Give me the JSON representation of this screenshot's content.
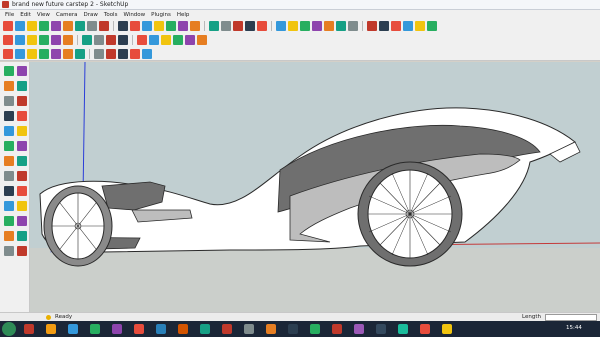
{
  "window": {
    "title": "brand new future carstep 2 - SketchUp"
  },
  "menu": [
    "File",
    "Edit",
    "View",
    "Camera",
    "Draw",
    "Tools",
    "Window",
    "Plugins",
    "Help"
  ],
  "status": {
    "message": "Ready",
    "length_label": "Length",
    "length_value": ""
  },
  "taskbar": {
    "time": "15:44"
  },
  "colors": {
    "sky": "#c1cfd1",
    "ground": "#cbcfcb",
    "axis_blue": "#2b3ed8",
    "axis_red": "#c43a3a",
    "car_body": "#ffffff",
    "car_panel": "#bdbdbd",
    "car_dark": "#6f6f6f",
    "taskbar": "#1b2637"
  },
  "icons": {
    "toolbar_row1": [
      "select-icon",
      "eraser-icon",
      "pencil-icon",
      "line-icon",
      "rectangle-icon",
      "circle-icon",
      "arc-icon",
      "polygon-icon",
      "freehand-icon",
      "push-pull-icon",
      "follow-me-icon",
      "offset-icon",
      "move-icon",
      "rotate-icon",
      "scale-icon",
      "tape-measure-icon",
      "dimension-icon",
      "protractor-icon",
      "text-icon",
      "axes-icon",
      "3d-text-icon",
      "orbit-icon",
      "pan-icon",
      "zoom-icon",
      "zoom-window-icon",
      "zoom-extents-icon",
      "previous-view-icon",
      "next-view-icon",
      "position-camera-icon",
      "walk-icon",
      "look-around-icon",
      "section-plane-icon",
      "get-models-icon",
      "share-model-icon"
    ],
    "toolbar_row2": [
      "component-icon",
      "group-icon",
      "materials-icon",
      "layers-icon",
      "sandbox-icon",
      "warehouse-icon",
      "styles-icon",
      "shadows-icon",
      "fog-icon",
      "xray-icon",
      "back-edges-icon",
      "wireframe-icon",
      "hidden-line-icon",
      "shaded-icon",
      "textured-icon",
      "monochrome-icon"
    ],
    "toolbar_row3": [
      "iso-view-icon",
      "top-view-icon",
      "front-view-icon",
      "right-view-icon",
      "back-view-icon",
      "left-view-icon",
      "bottom-view-icon",
      "camera-icon",
      "flag-icon",
      "layers-panel-icon",
      "google-earth-icon",
      "photo-icon"
    ]
  }
}
